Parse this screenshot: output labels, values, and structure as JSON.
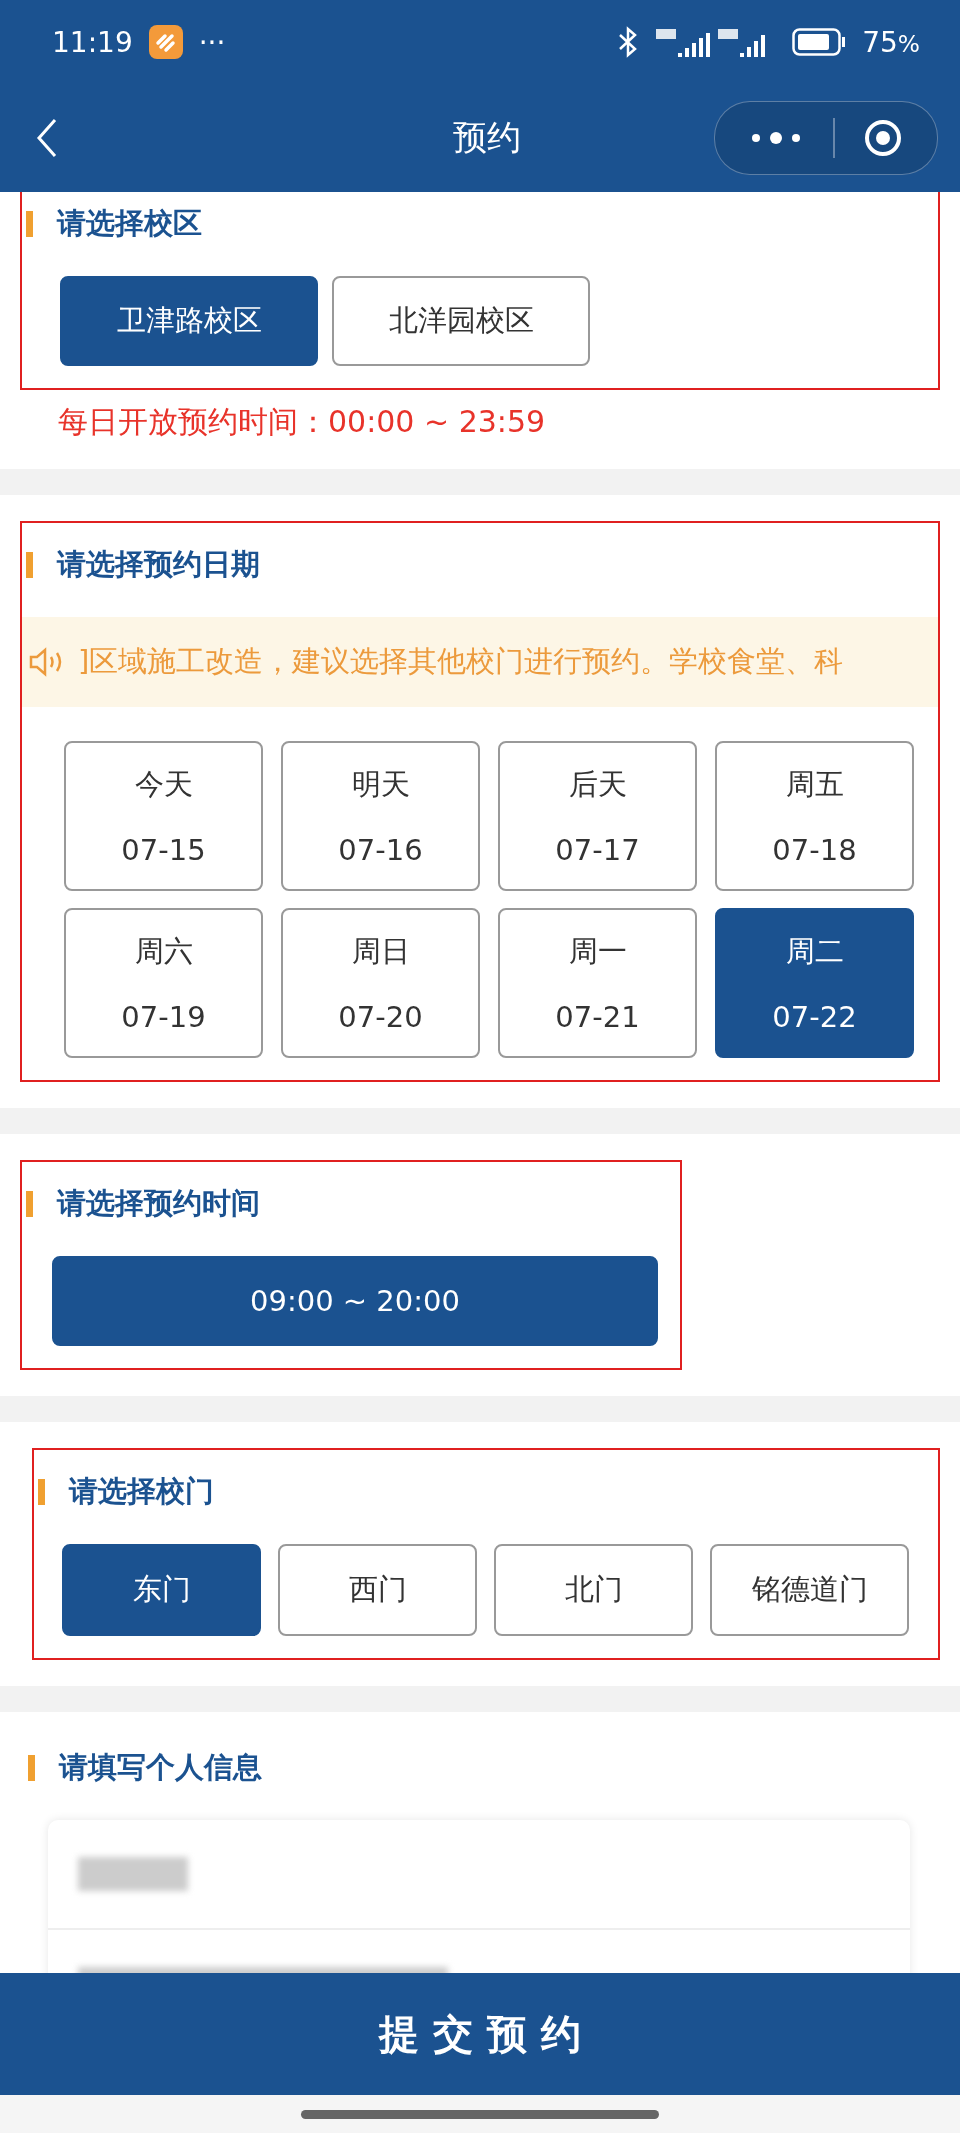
{
  "status_bar": {
    "time": "11:19",
    "more": "···",
    "battery": "75",
    "battery_unit": "%"
  },
  "nav": {
    "title": "预约"
  },
  "campus": {
    "title": "请选择校区",
    "highlighted": true,
    "options": [
      {
        "label": "卫津路校区",
        "selected": true
      },
      {
        "label": "北洋园校区",
        "selected": false
      }
    ],
    "notice": "每日开放预约时间：00:00 ~ 23:59"
  },
  "date": {
    "title": "请选择预约日期",
    "highlighted": true,
    "marquee": "]区域施工改造，建议选择其他校门进行预约。学校食堂、科",
    "options": [
      {
        "day": "今天",
        "date": "07-15",
        "selected": false
      },
      {
        "day": "明天",
        "date": "07-16",
        "selected": false
      },
      {
        "day": "后天",
        "date": "07-17",
        "selected": false
      },
      {
        "day": "周五",
        "date": "07-18",
        "selected": false
      },
      {
        "day": "周六",
        "date": "07-19",
        "selected": false
      },
      {
        "day": "周日",
        "date": "07-20",
        "selected": false
      },
      {
        "day": "周一",
        "date": "07-21",
        "selected": false
      },
      {
        "day": "周二",
        "date": "07-22",
        "selected": true
      }
    ]
  },
  "time": {
    "title": "请选择预约时间",
    "highlighted": true,
    "options": [
      {
        "label": "09:00 ~ 20:00",
        "selected": true
      }
    ]
  },
  "gate": {
    "title": "请选择校门",
    "highlighted": true,
    "options": [
      {
        "label": "东门",
        "selected": true
      },
      {
        "label": "西门",
        "selected": false
      },
      {
        "label": "北门",
        "selected": false
      },
      {
        "label": "铭德道门",
        "selected": false
      }
    ]
  },
  "personal_info": {
    "title": "请填写个人信息",
    "fields": [
      {
        "redacted": true
      },
      {
        "redacted": true
      }
    ]
  },
  "submit": {
    "label": "提 交 预 约"
  }
}
